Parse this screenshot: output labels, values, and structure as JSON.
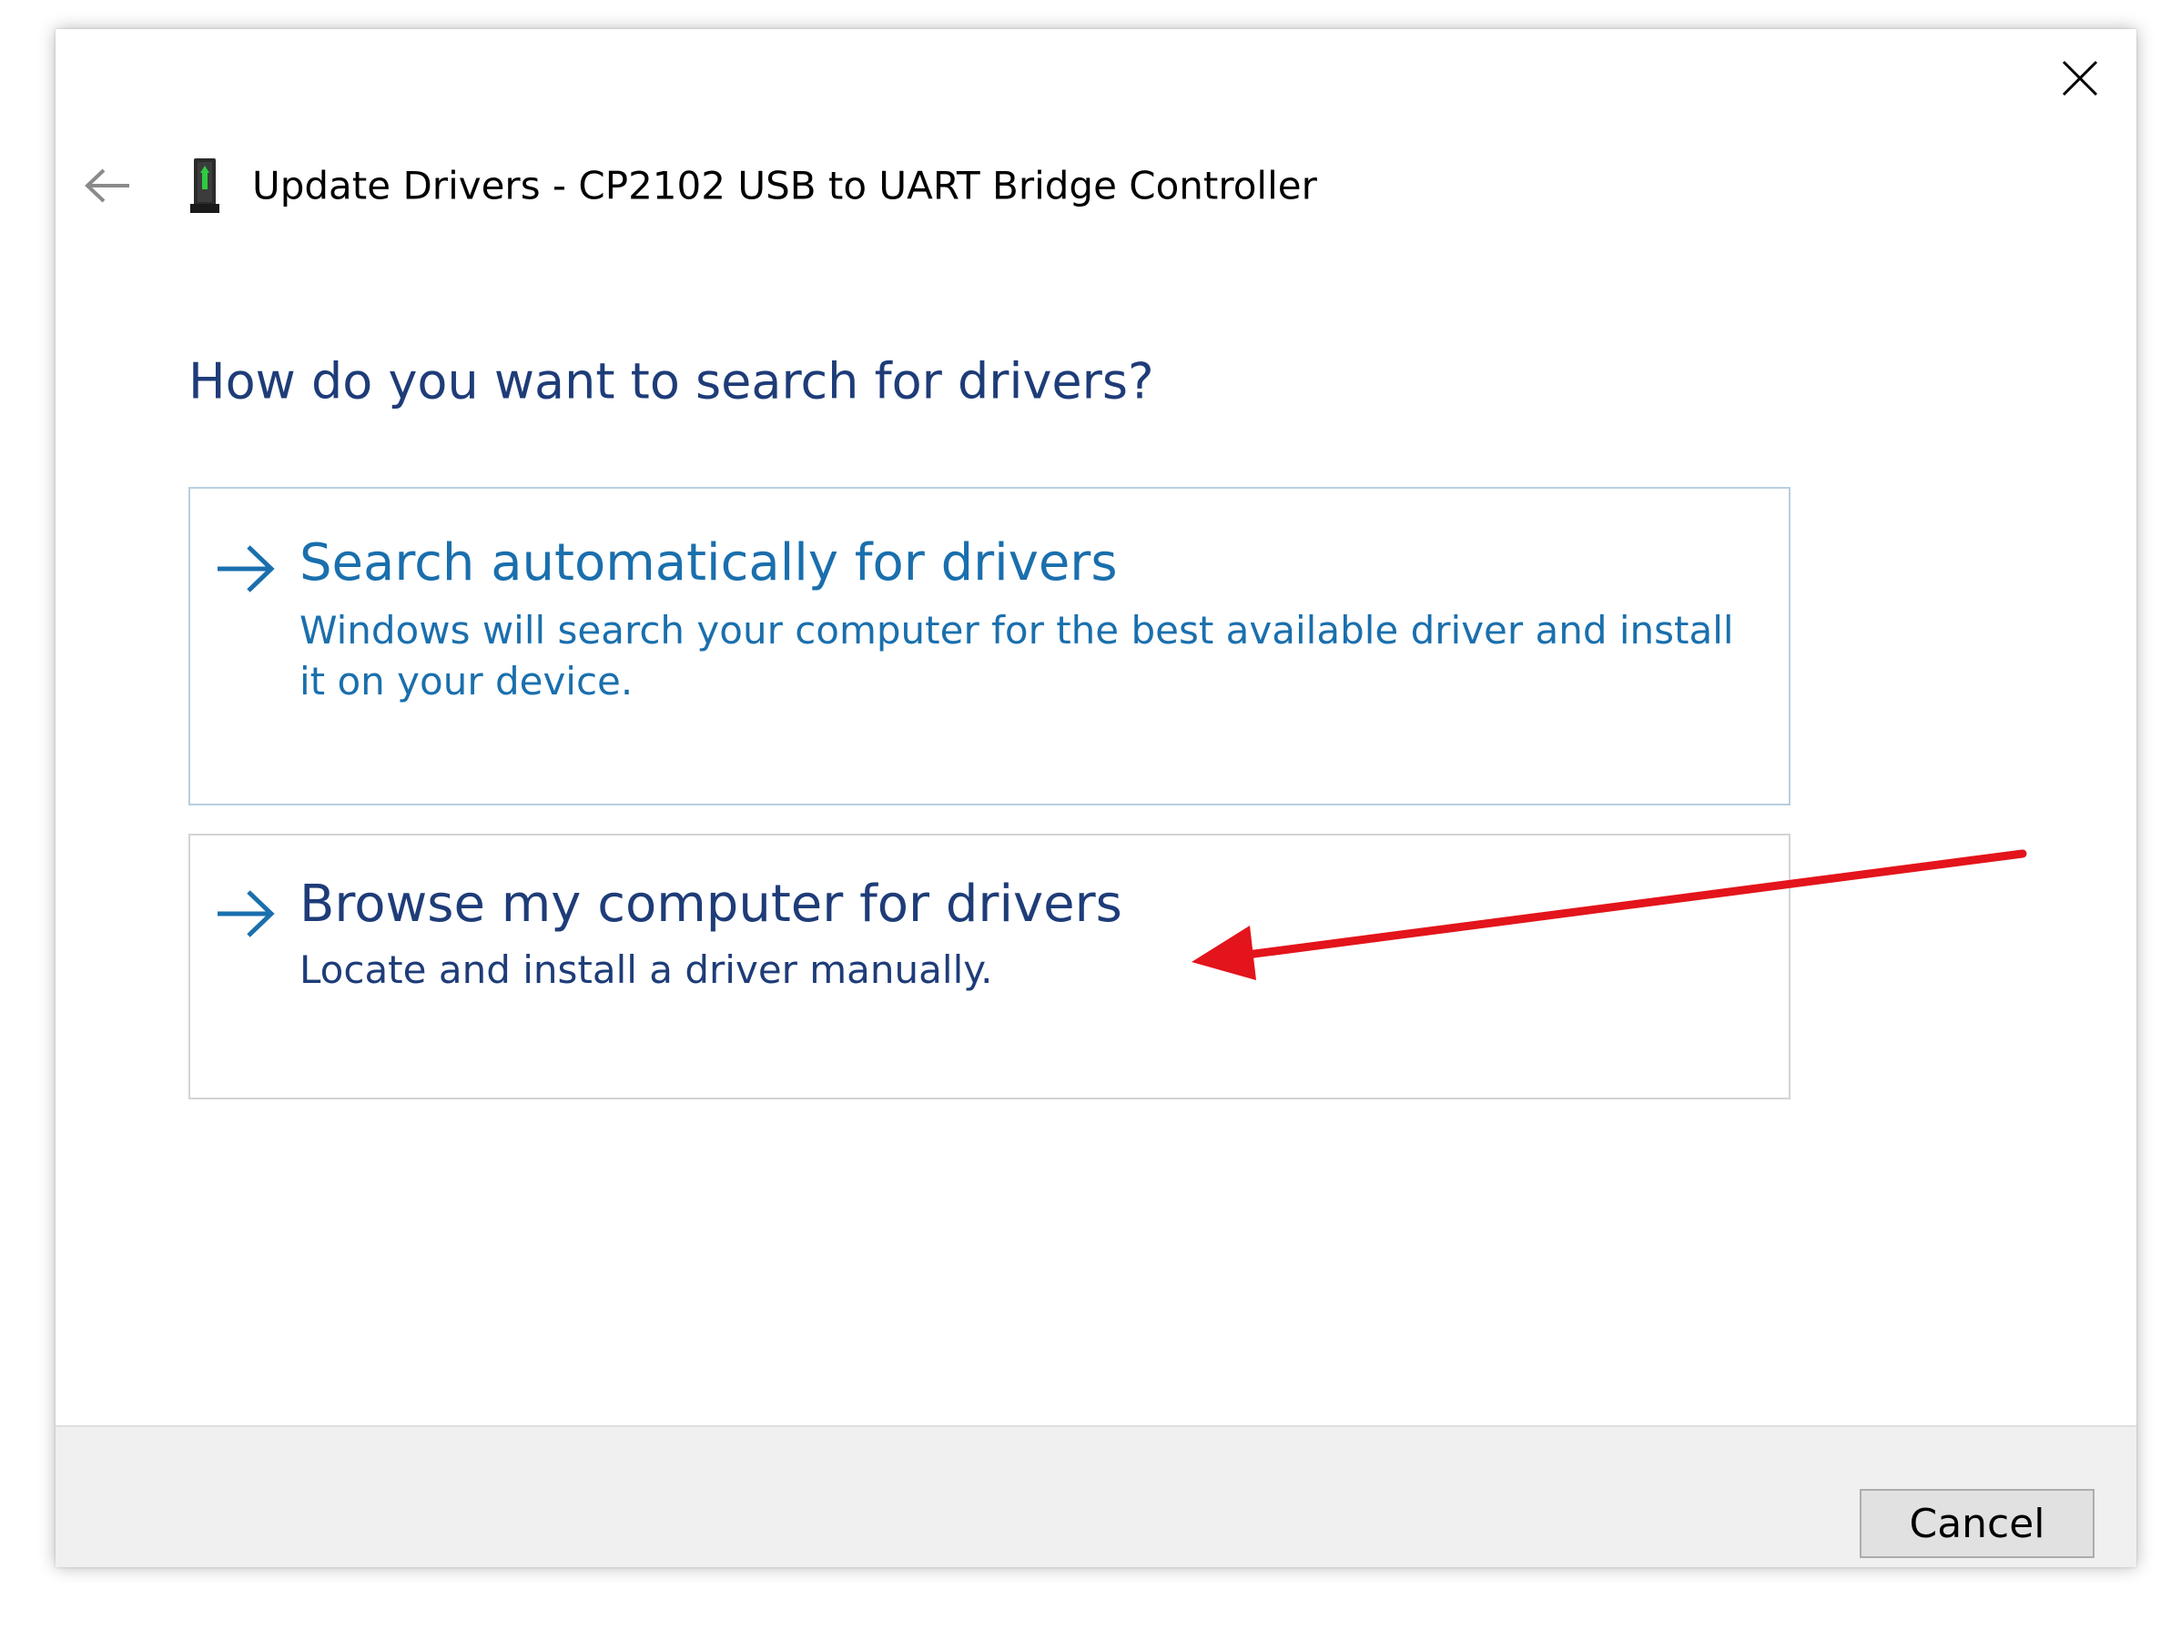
{
  "dialog": {
    "title": "Update Drivers - CP2102 USB to UART Bridge Controller",
    "heading": "How do you want to search for drivers?"
  },
  "icons": {
    "close": "close-icon",
    "back": "back-arrow-icon",
    "device": "usb-device-icon",
    "option_arrow": "right-arrow-icon"
  },
  "options": [
    {
      "title": "Search automatically for drivers",
      "description": "Windows will search your computer for the best available driver and install it on your device."
    },
    {
      "title": "Browse my computer for drivers",
      "description": "Locate and install a driver manually."
    }
  ],
  "footer": {
    "cancel_label": "Cancel"
  },
  "colors": {
    "heading": "#1e3c78",
    "link": "#1a6fad",
    "option_border": "#b8cfe0",
    "footer_bg": "#f0f0f0",
    "annotation_arrow": "#e3141b"
  }
}
